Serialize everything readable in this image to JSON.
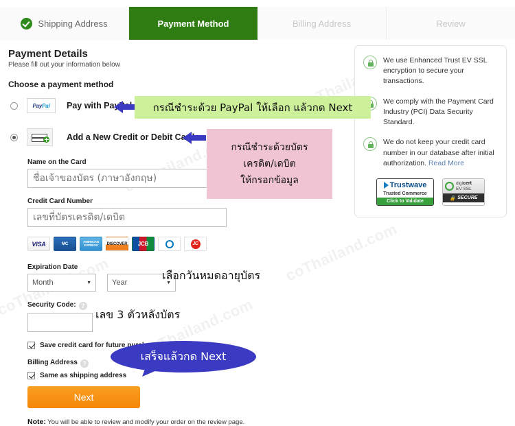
{
  "watermarks": [
    "coThailand.com",
    "coThailand.com",
    "coThailand.com",
    "coThailand.com",
    "coThailand.com",
    "coThailand.com"
  ],
  "steps": [
    {
      "label": "Shipping Address",
      "state": "done",
      "icon": "check-circle-icon"
    },
    {
      "label": "Payment Method",
      "state": "active",
      "icon": ""
    },
    {
      "label": "Billing Address",
      "state": "inactive",
      "icon": ""
    },
    {
      "label": "Review",
      "state": "inactive",
      "icon": ""
    }
  ],
  "page": {
    "title": "Payment Details",
    "subtitle": "Please fill out your information below",
    "choose_label": "Choose a payment method"
  },
  "payment_options": [
    {
      "label": "Pay with PayPal",
      "selected": false,
      "logo": "paypal-logo",
      "logo_text_a": "Pay",
      "logo_text_b": "Pal"
    },
    {
      "label": "Add a New Credit or Debit Card",
      "selected": true,
      "logo": "add-card-icon"
    }
  ],
  "form": {
    "name_label": "Name on the Card",
    "name_placeholder": "ชื่อเจ้าของบัตร (ภาษาอังกฤษ)",
    "number_label": "Credit Card Number",
    "number_placeholder": "เลขที่บัตรเครดิต/เดบิต",
    "expiration_label": "Expiration Date",
    "month_value": "Month",
    "year_value": "Year",
    "security_label": "Security Code:",
    "security_value": "",
    "save_card_label": "Save credit card for future purchases",
    "save_card_checked": true,
    "billing_label": "Billing Address",
    "same_as_shipping_label": "Same as shipping address",
    "same_as_shipping_checked": true,
    "next_label": "Next",
    "note_prefix": "Note:",
    "note_text": " You will be able to review and modify your order on the review page."
  },
  "card_logos": [
    {
      "name": "visa-logo",
      "text": "VISA"
    },
    {
      "name": "mastercard-logo",
      "text": "MasterCard"
    },
    {
      "name": "amex-logo",
      "text": "AMERICAN EXPRESS"
    },
    {
      "name": "discover-logo",
      "text": "DISCOVER"
    },
    {
      "name": "jcb-logo",
      "text": "JCB"
    },
    {
      "name": "diners-club-logo",
      "text": ""
    },
    {
      "name": "jcb-red-logo",
      "text": "JC"
    }
  ],
  "annotations": {
    "green_note": "กรณีชำระด้วย PayPal ให้เลือก แล้วกด Next",
    "pink_note_lines": [
      "กรณีชำระด้วยบัตร",
      "เครดิต/เดบิต",
      "ให้กรอกข้อมูล"
    ],
    "expiry_note": "เลือกวันหมดอายุบัตร",
    "cvv_note": "เลข 3 ตัวหลังบัตร",
    "next_note": "เสร็จแล้วกด Next"
  },
  "security_panel": {
    "items": [
      {
        "text": "We use Enhanced Trust EV SSL encryption to secure your transactions.",
        "link": ""
      },
      {
        "text": "We comply with the Payment Card Industry (PCI) Data Security Standard.",
        "link": ""
      },
      {
        "text": "We do not keep your credit card number in our database after initial authorization.",
        "link": "Read More"
      }
    ],
    "trustwave": {
      "name": "Trustwave",
      "tagline": "Trusted Commerce",
      "cta": "Click to Validate"
    },
    "digicert": {
      "brand_a": "digi",
      "brand_b": "cert",
      "sub": "EV SSL",
      "secure": "SECURE"
    }
  },
  "colors": {
    "active_tab_green": "#2f7d12",
    "next_button_orange": "#f58608",
    "annotation_green": "#cdf09a",
    "annotation_pink": "#f0c4d2",
    "annotation_blue": "#3a3ac2",
    "check_green": "#2f8a1c"
  }
}
